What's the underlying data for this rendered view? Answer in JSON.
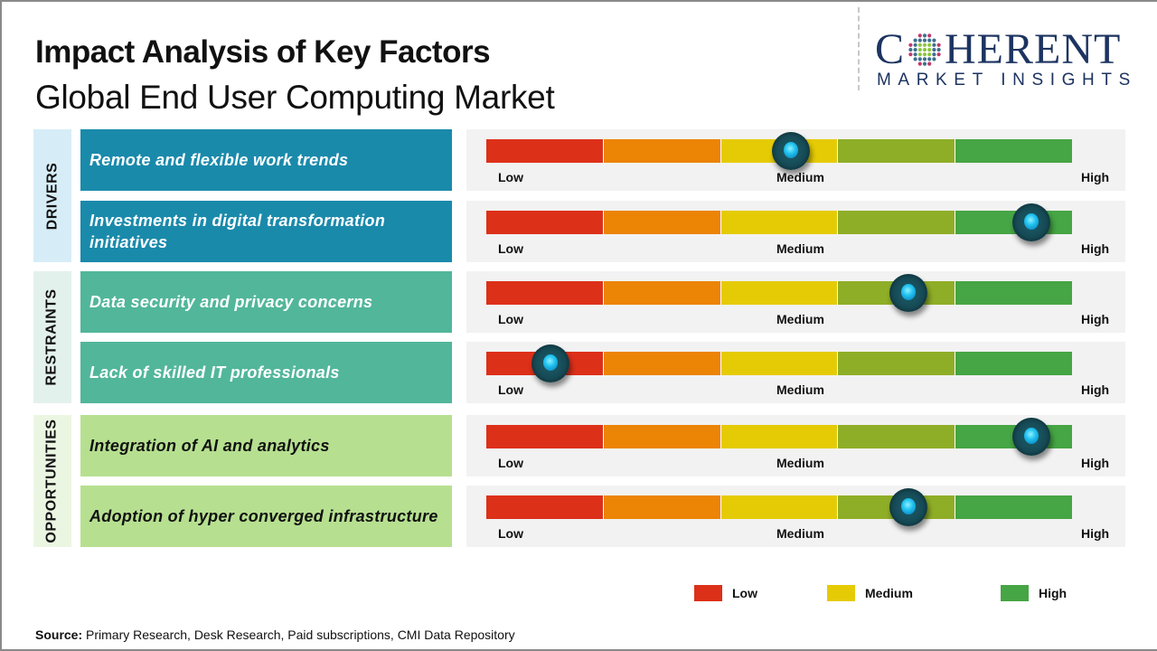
{
  "header": {
    "title": "Impact Analysis of Key Factors",
    "subtitle": "Global End User Computing Market"
  },
  "logo": {
    "main_left": "C",
    "main_right": "HERENT",
    "sub": "MARKET INSIGHTS",
    "icon": "globe-dots-icon"
  },
  "colors": {
    "drivers_factor_bg": "#1a8aab",
    "drivers_label_bg": "#d6edf7",
    "restraints_factor_bg": "#52b69a",
    "restraints_label_bg": "#e3f1ec",
    "opportunities_factor_bg": "#b6e090",
    "opportunities_label_bg": "#ebf6e2",
    "segments": [
      "#dd3019",
      "#ec8405",
      "#e5cb05",
      "#8fae27",
      "#46a544"
    ]
  },
  "chart_data": {
    "type": "gauge-scale",
    "title": "Impact Analysis of Key Factors",
    "subtitle": "Global End User Computing Market",
    "scale": {
      "min_label": "Low",
      "mid_label": "Medium",
      "max_label": "High",
      "range": [
        0,
        1
      ],
      "segments": 5
    },
    "categories": [
      {
        "name": "DRIVERS",
        "factors": [
          {
            "label": "Remote and flexible work trends",
            "value": 0.52,
            "level": "Medium"
          },
          {
            "label": "Investments in digital transformation initiatives",
            "value": 0.93,
            "level": "High"
          }
        ]
      },
      {
        "name": "RESTRAINTS",
        "factors": [
          {
            "label": "Data security and privacy concerns",
            "value": 0.72,
            "level": "Medium-High"
          },
          {
            "label": "Lack of skilled IT professionals",
            "value": 0.11,
            "level": "Low"
          }
        ]
      },
      {
        "name": "OPPORTUNITIES",
        "factors": [
          {
            "label": "Integration  of AI and analytics",
            "value": 0.93,
            "level": "High"
          },
          {
            "label": "Adoption  of hyper converged  infrastructure",
            "value": 0.72,
            "level": "Medium-High"
          }
        ]
      }
    ],
    "legend": [
      {
        "label": "Low",
        "color": "#dd3019"
      },
      {
        "label": "Medium",
        "color": "#e5cb05"
      },
      {
        "label": "High",
        "color": "#46a544"
      }
    ],
    "legend_position": "bottom-right"
  },
  "footer": {
    "source_label": "Source:",
    "source_text": " Primary Research, Desk Research, Paid subscriptions, CMI Data Repository"
  }
}
